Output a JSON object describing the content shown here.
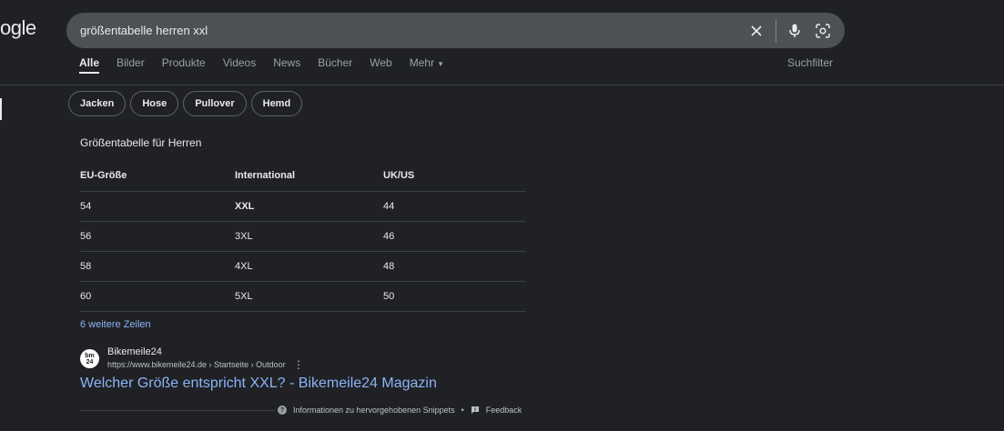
{
  "logo_text": "ogle",
  "search": {
    "value": "größentabelle herren xxl"
  },
  "tabs": [
    "Alle",
    "Bilder",
    "Produkte",
    "Videos",
    "News",
    "Bücher",
    "Web",
    "Mehr"
  ],
  "suchfilter": "Suchfilter",
  "chips": [
    "Jacken",
    "Hose",
    "Pullover",
    "Hemd"
  ],
  "table": {
    "title": "Größentabelle für Herren",
    "headers": [
      "EU-Größe",
      "International",
      "UK/US"
    ],
    "rows": [
      [
        "54",
        "XXL",
        "44"
      ],
      [
        "56",
        "3XL",
        "46"
      ],
      [
        "58",
        "4XL",
        "48"
      ],
      [
        "60",
        "5XL",
        "50"
      ]
    ],
    "more": "6 weitere Zeilen"
  },
  "result": {
    "favicon_top": "bm",
    "favicon_bottom": "24",
    "site": "Bikemeile24",
    "url": "https://www.bikemeile24.de › Startseite › Outdoor",
    "title": "Welcher Größe entspricht XXL? - Bikemeile24 Magazin"
  },
  "footer": {
    "info": "Informationen zu hervorgehobenen Snippets",
    "feedback": "Feedback"
  }
}
